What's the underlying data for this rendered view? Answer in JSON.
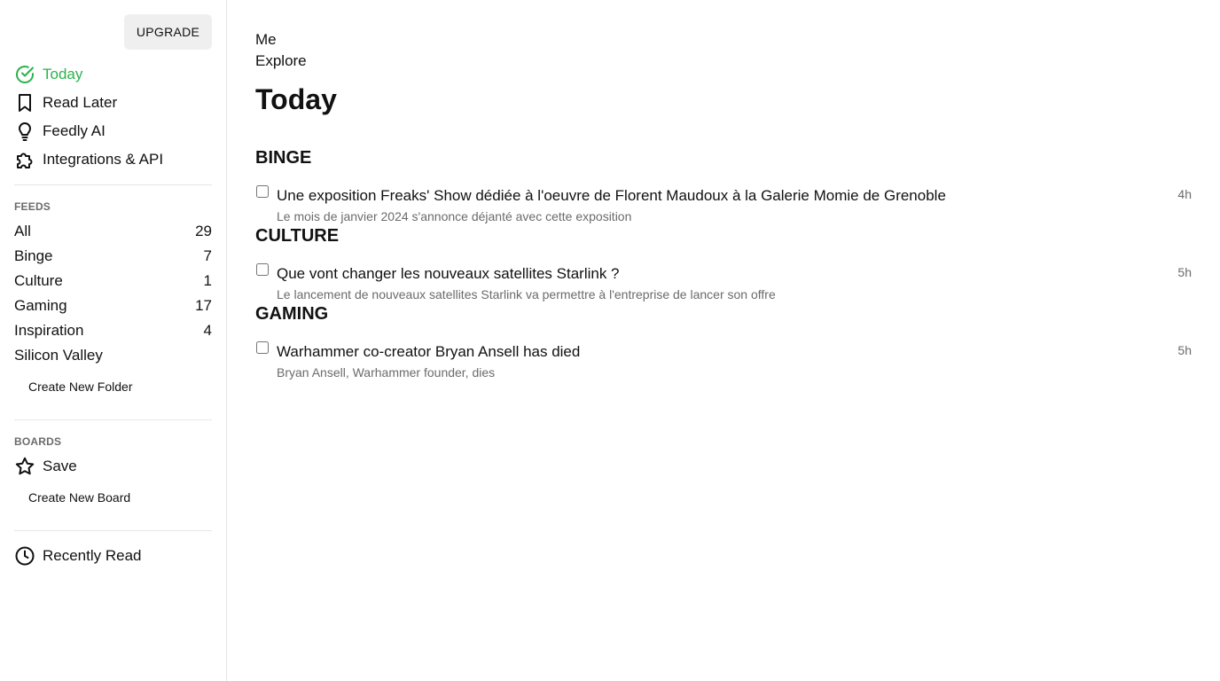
{
  "sidebar": {
    "upgrade_label": "UPGRADE",
    "nav": [
      {
        "label": "Today",
        "icon": "check-circle-icon",
        "active": true
      },
      {
        "label": "Read Later",
        "icon": "bookmark-icon"
      },
      {
        "label": "Feedly AI",
        "icon": "lightbulb-icon"
      },
      {
        "label": "Integrations & API",
        "icon": "puzzle-icon"
      }
    ],
    "feeds_title": "FEEDS",
    "feeds": [
      {
        "label": "All",
        "count": "29"
      },
      {
        "label": "Binge",
        "count": "7"
      },
      {
        "label": "Culture",
        "count": "1"
      },
      {
        "label": "Gaming",
        "count": "17"
      },
      {
        "label": "Inspiration",
        "count": "4"
      },
      {
        "label": "Silicon Valley",
        "count": ""
      }
    ],
    "create_folder_label": "Create New Folder",
    "boards_title": "BOARDS",
    "boards": [
      {
        "label": "Save",
        "icon": "star-icon"
      }
    ],
    "create_board_label": "Create New Board",
    "recently_read_label": "Recently Read"
  },
  "main": {
    "top_links": [
      "Me",
      "Explore"
    ],
    "title": "Today",
    "groups": [
      {
        "title": "BINGE",
        "articles": [
          {
            "title": "Une exposition Freaks' Show dédiée à l'oeuvre de Florent Maudoux à la Galerie Momie de Grenoble",
            "summary": "Le mois de janvier 2024 s'annonce déjanté avec cette exposition",
            "age": "4h"
          }
        ]
      },
      {
        "title": "CULTURE",
        "articles": [
          {
            "title": "Que vont changer les nouveaux satellites Starlink ?",
            "summary": "Le lancement de nouveaux satellites Starlink va permettre à l'entreprise de lancer son offre",
            "age": "5h"
          }
        ]
      },
      {
        "title": "GAMING",
        "articles": [
          {
            "title": "Warhammer co-creator Bryan Ansell has died",
            "summary": "Bryan Ansell, Warhammer founder, dies",
            "age": "5h"
          }
        ]
      }
    ]
  },
  "colors": {
    "accent": "#2bb24c",
    "muted_text": "#6b6b6b",
    "divider": "#e6e6e6",
    "upgrade_bg": "#efefef"
  }
}
